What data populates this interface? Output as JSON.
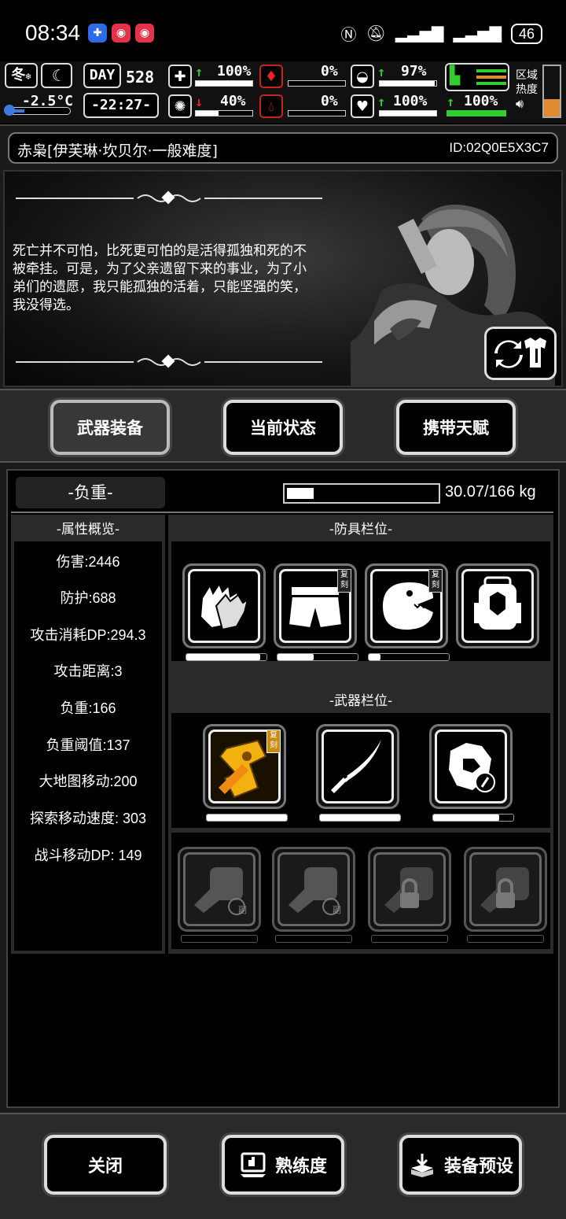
{
  "status_bar": {
    "time": "08:34",
    "battery": "46",
    "app_icons": [
      "blue-app-icon",
      "red-app-icon",
      "red-app-icon"
    ]
  },
  "hud": {
    "season": "冬",
    "temperature": "-2.5°C",
    "day_label": "DAY",
    "day_number": "528",
    "clock": "-22:27-",
    "health_pct": "100%",
    "health_level": 1.0,
    "mental_pct": "40%",
    "mental_level": 0.4,
    "hunger_pct": "0%",
    "hunger_level": 0,
    "blood_pct": "0%",
    "blood_level": 0,
    "stamina_pct": "97%",
    "stamina_level": 0.97,
    "heart_pct": "100%",
    "heart_level": 1.0,
    "boots_pct": "100%",
    "boots_level": 1.0,
    "zone_heat_label": "区域热度",
    "zone_heat_level": 0.35
  },
  "character": {
    "name": "赤枭[伊芙琳·坎贝尔·一般难度]",
    "id": "ID:02Q0E5X3C7",
    "bio": "死亡并不可怕，比死更可怕的是活得孤独和死的不被牵挂。可是，为了父亲遗留下来的事业，为了小弟们的遗愿，我只能孤独的活着，只能坚强的笑，我没得选。"
  },
  "tabs": [
    {
      "label": "武器装备",
      "active": true
    },
    {
      "label": "当前状态",
      "active": false
    },
    {
      "label": "携带天赋",
      "active": false
    }
  ],
  "weight": {
    "label": "-负重-",
    "value": "30.07/166 kg",
    "fraction": 0.181
  },
  "stats": {
    "title": "-属性概览-",
    "items": [
      "伤害:2446",
      "防护:688",
      "攻击消耗DP:294.3",
      "攻击距离:3",
      "负重:166",
      "负重阈值:137",
      "大地图移动:200",
      "探索移动速度: 303",
      "战斗移动DP: 149"
    ]
  },
  "armor": {
    "title": "-防具栏位-",
    "slots": [
      {
        "icon": "gloves-icon",
        "durability": 0.92,
        "tag": ""
      },
      {
        "icon": "shorts-icon",
        "durability": 0.45,
        "tag": "复刻"
      },
      {
        "icon": "dino-mask-icon",
        "durability": 0.15,
        "tag": "复刻"
      },
      {
        "icon": "backpack-icon",
        "durability": null,
        "tag": ""
      }
    ]
  },
  "weapons": {
    "title": "-武器栏位-",
    "slots": [
      {
        "icon": "golden-gun-icon",
        "durability": 1.0,
        "tag": "复刻"
      },
      {
        "icon": "katana-icon",
        "durability": 1.0,
        "tag": ""
      },
      {
        "icon": "armor-plate-icon",
        "durability": 0.82,
        "tag": ""
      }
    ],
    "secondary": [
      {
        "icon": "fist-icon",
        "badge": "副",
        "locked": false
      },
      {
        "icon": "fist-icon",
        "badge": "副",
        "locked": false
      },
      {
        "icon": "fist-icon",
        "badge": "",
        "locked": true
      },
      {
        "icon": "fist-icon",
        "badge": "",
        "locked": true
      }
    ]
  },
  "bottom_buttons": [
    {
      "label": "关闭",
      "icon": ""
    },
    {
      "label": "熟练度",
      "icon": "proficiency-icon"
    },
    {
      "label": "装备预设",
      "icon": "equipment-preset-icon"
    }
  ]
}
